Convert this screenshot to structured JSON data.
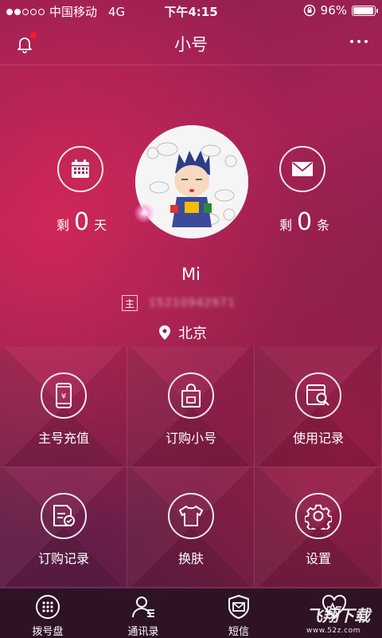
{
  "status_bar": {
    "carrier": "中国移动",
    "network": "4G",
    "time": "下午4:15",
    "battery": "96%",
    "battery_level": 0.96
  },
  "nav": {
    "title": "小号",
    "notification_icon": "bell-icon",
    "more_icon": "more-icon"
  },
  "profile": {
    "days": {
      "prefix": "剩",
      "value": "0",
      "unit": "天",
      "icon": "calendar-icon"
    },
    "messages": {
      "prefix": "剩",
      "value": "0",
      "unit": "条",
      "icon": "envelope-icon"
    },
    "name": "Mi",
    "main_tag": "主",
    "phone": "15210942971",
    "location": "北京",
    "location_icon": "location-pin-icon"
  },
  "grid": [
    {
      "label": "主号充值",
      "icon": "phone-yuan-icon"
    },
    {
      "label": "订购小号",
      "icon": "shopping-bag-icon"
    },
    {
      "label": "使用记录",
      "icon": "search-record-icon"
    },
    {
      "label": "订购记录",
      "icon": "order-record-icon"
    },
    {
      "label": "换肤",
      "icon": "tshirt-icon"
    },
    {
      "label": "设置",
      "icon": "gear-icon"
    }
  ],
  "tabs": [
    {
      "label": "拨号盘",
      "icon": "dialpad-icon"
    },
    {
      "label": "通讯录",
      "icon": "contacts-icon"
    },
    {
      "label": "短信",
      "icon": "sms-shield-icon"
    },
    {
      "label": "",
      "icon": "heart-icon"
    }
  ],
  "watermark": {
    "text": "飞翔下载",
    "sub": "www.52z.com"
  }
}
